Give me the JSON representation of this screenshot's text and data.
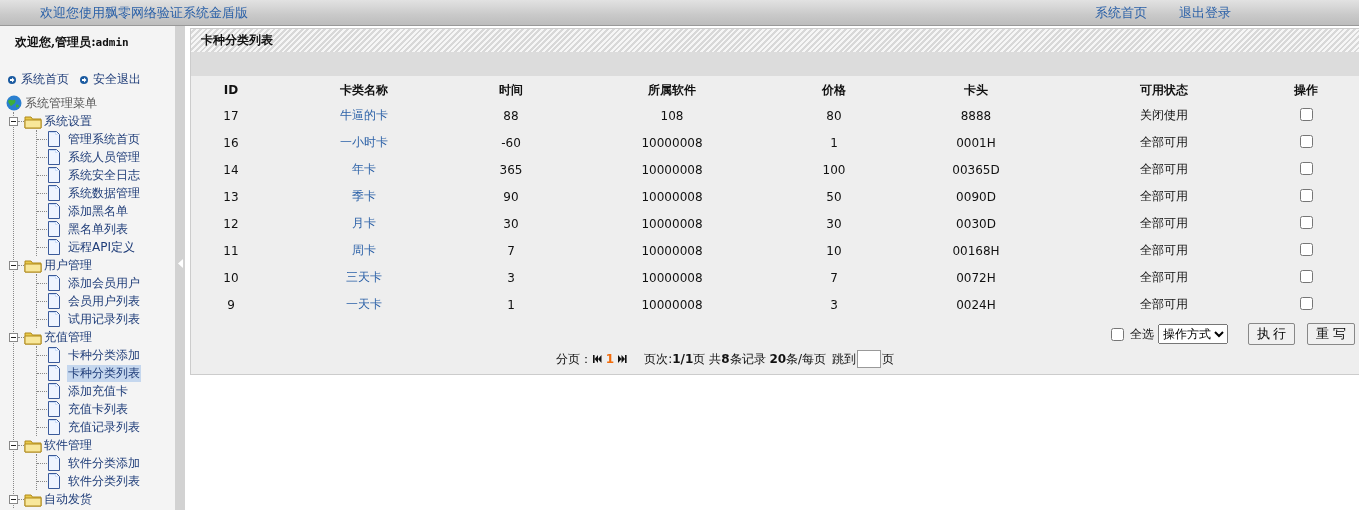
{
  "header": {
    "title": "欢迎您使用飘零网络验证系统金盾版",
    "links": [
      "系统首页",
      "退出登录"
    ]
  },
  "sidebar": {
    "greeting": "欢迎您,管理员:",
    "user": "admin",
    "quick_links": [
      "系统首页",
      "安全退出"
    ],
    "menu": {
      "title": "系统管理菜单",
      "groups": [
        {
          "label": "系统设置",
          "expanded": true,
          "children": [
            {
              "label": "管理系统首页",
              "selected": false
            },
            {
              "label": "系统人员管理",
              "selected": false
            },
            {
              "label": "系统安全日志",
              "selected": false
            },
            {
              "label": "系统数据管理",
              "selected": false
            },
            {
              "label": "添加黑名单",
              "selected": false
            },
            {
              "label": "黑名单列表",
              "selected": false
            },
            {
              "label": "远程API定义",
              "selected": false
            }
          ]
        },
        {
          "label": "用户管理",
          "expanded": true,
          "children": [
            {
              "label": "添加会员用户",
              "selected": false
            },
            {
              "label": "会员用户列表",
              "selected": false
            },
            {
              "label": "试用记录列表",
              "selected": false
            }
          ]
        },
        {
          "label": "充值管理",
          "expanded": true,
          "children": [
            {
              "label": "卡种分类添加",
              "selected": false
            },
            {
              "label": "卡种分类列表",
              "selected": true
            },
            {
              "label": "添加充值卡",
              "selected": false
            },
            {
              "label": "充值卡列表",
              "selected": false
            },
            {
              "label": "充值记录列表",
              "selected": false
            }
          ]
        },
        {
          "label": "软件管理",
          "expanded": true,
          "children": [
            {
              "label": "软件分类添加",
              "selected": false
            },
            {
              "label": "软件分类列表",
              "selected": false
            }
          ]
        },
        {
          "label": "自动发货",
          "expanded": true
        }
      ]
    }
  },
  "panel": {
    "title": "卡种分类列表",
    "table": {
      "columns": [
        "ID",
        "卡类名称",
        "时间",
        "所属软件",
        "价格",
        "卡头",
        "可用状态",
        "操作"
      ],
      "rows": [
        {
          "id": "17",
          "name": "牛逼的卡",
          "time": "88",
          "software": "108",
          "price": "80",
          "prefix": "8888",
          "status": "关闭使用",
          "checked": false
        },
        {
          "id": "16",
          "name": "一小时卡",
          "time": "-60",
          "software": "10000008",
          "price": "1",
          "prefix": "0001H",
          "status": "全部可用",
          "checked": false
        },
        {
          "id": "14",
          "name": "年卡",
          "time": "365",
          "software": "10000008",
          "price": "100",
          "prefix": "00365D",
          "status": "全部可用",
          "checked": false
        },
        {
          "id": "13",
          "name": "季卡",
          "time": "90",
          "software": "10000008",
          "price": "50",
          "prefix": "0090D",
          "status": "全部可用",
          "checked": false
        },
        {
          "id": "12",
          "name": "月卡",
          "time": "30",
          "software": "10000008",
          "price": "30",
          "prefix": "0030D",
          "status": "全部可用",
          "checked": false
        },
        {
          "id": "11",
          "name": "周卡",
          "time": "7",
          "software": "10000008",
          "price": "10",
          "prefix": "00168H",
          "status": "全部可用",
          "checked": false
        },
        {
          "id": "10",
          "name": "三天卡",
          "time": "3",
          "software": "10000008",
          "price": "7",
          "prefix": "0072H",
          "status": "全部可用",
          "checked": false
        },
        {
          "id": "9",
          "name": "一天卡",
          "time": "1",
          "software": "10000008",
          "price": "3",
          "prefix": "0024H",
          "status": "全部可用",
          "checked": false
        }
      ]
    },
    "actions": {
      "select_all": {
        "label": "全选",
        "checked": false
      },
      "dropdown": "操作方式",
      "buttons": [
        "执 行",
        "重 写"
      ]
    },
    "pagination": {
      "label": "分页：",
      "current": "1",
      "summary": "页次:**1/1**页 共**8**条记录 **20**条/每页",
      "jump_label": "跳到",
      "jump_suffix": "页"
    }
  }
}
